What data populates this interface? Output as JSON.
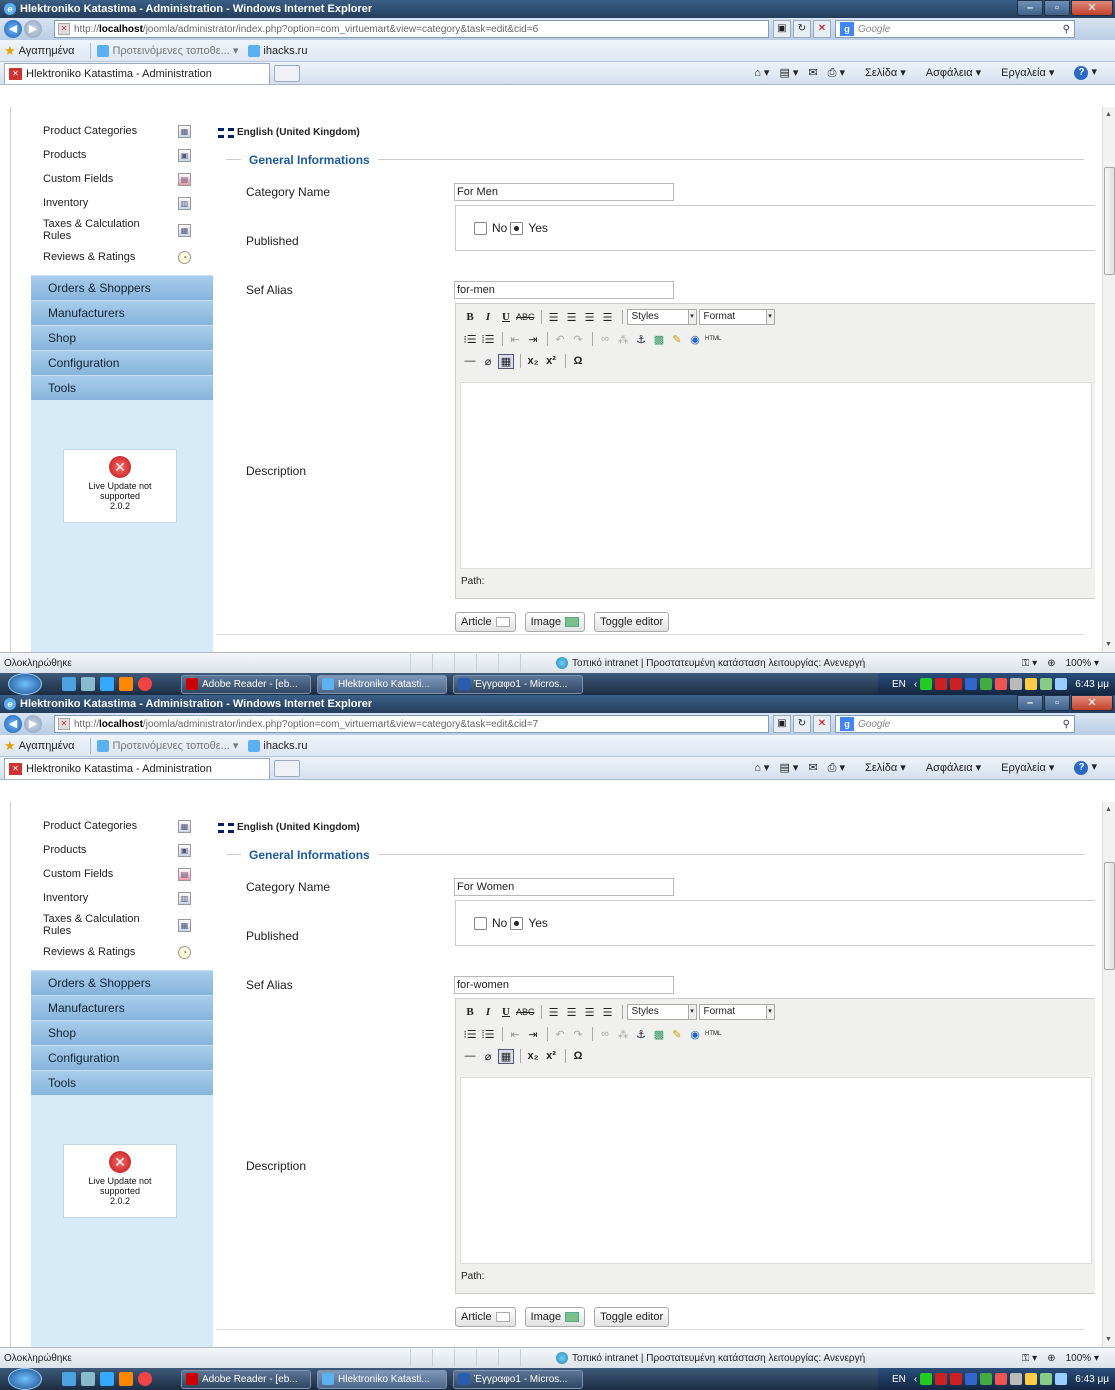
{
  "screens": [
    {
      "window_title": "Hlektroniko Katastima - Administration - Windows Internet Explorer",
      "url_prefix": "http://",
      "url_host": "localhost",
      "url_path": "/joomla/administrator/index.php?option=com_virtuemart&view=category&task=edit&cid=6",
      "category_name": "For Men",
      "sef_alias": "for-men"
    },
    {
      "window_title": "Hlektroniko Katastima - Administration - Windows Internet Explorer",
      "url_prefix": "http://",
      "url_host": "localhost",
      "url_path": "/joomla/administrator/index.php?option=com_virtuemart&view=category&task=edit&cid=7",
      "category_name": "For Women",
      "sef_alias": "for-women"
    }
  ],
  "search_placeholder": "Google",
  "favorites": {
    "label": "Αγαπημένα",
    "suggested": "Προτεινόμενες τοποθε...",
    "site": "ihacks.ru"
  },
  "tab_title": "Hlektroniko Katastima - Administration",
  "command_bar": {
    "page": "Σελίδα",
    "safety": "Ασφάλεια",
    "tools": "Εργαλεία",
    "help": "?"
  },
  "sidebar": {
    "links": [
      {
        "label": "Product Categories",
        "icon": "folder-icon"
      },
      {
        "label": "Products",
        "icon": "box-icon"
      },
      {
        "label": "Custom Fields",
        "icon": "fields-icon"
      },
      {
        "label": "Inventory",
        "icon": "inventory-icon"
      },
      {
        "label": "Taxes & Calculation Rules",
        "icon": "calculator-icon"
      },
      {
        "label": "Reviews & Ratings",
        "icon": "bubble-icon"
      }
    ],
    "sections": [
      "Orders & Shoppers",
      "Manufacturers",
      "Shop",
      "Configuration",
      "Tools"
    ],
    "live_update_line1": "Live Update not",
    "live_update_line2": "supported",
    "live_update_version": "2.0.2"
  },
  "form": {
    "language": "English (United Kingdom)",
    "legend": "General Informations",
    "label_category_name": "Category Name",
    "label_published": "Published",
    "label_sef_alias": "Sef Alias",
    "label_description": "Description",
    "radio_no": "No",
    "radio_yes": "Yes",
    "published_value": "Yes",
    "styles": "Styles",
    "format": "Format",
    "path_label": "Path:",
    "btn_article": "Article",
    "btn_image": "Image",
    "btn_toggle": "Toggle editor"
  },
  "status": {
    "done": "Ολοκληρώθηκε",
    "zone": "Τοπικό intranet | Προστατευμένη κατάσταση λειτουργίας: Ανενεργή",
    "zoom": "100%"
  },
  "taskbar": {
    "tasks": [
      "Adobe Reader - [eb...",
      "Hlektroniko Katasti...",
      "Έγγραφο1 - Micros..."
    ],
    "lang": "EN",
    "time": "6:43 μμ"
  }
}
